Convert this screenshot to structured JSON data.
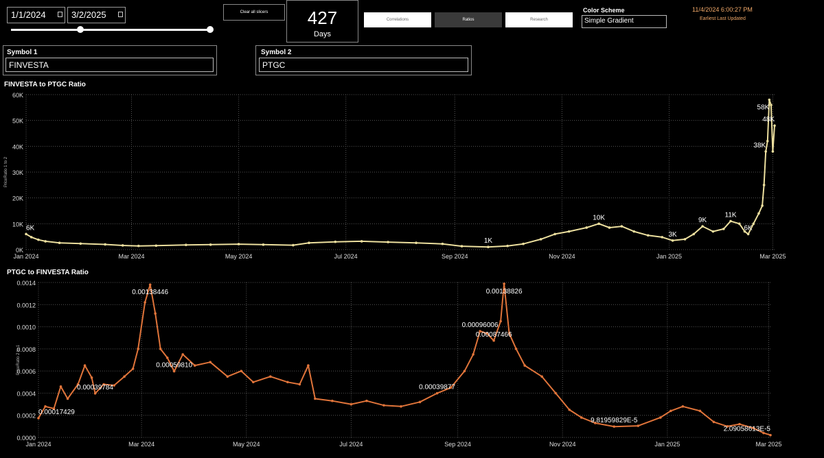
{
  "date_slicer": {
    "start": "1/1/2024",
    "end": "3/2/2025"
  },
  "clear_button": "Clear all slicers",
  "days_card": {
    "value": "427",
    "label": "Days"
  },
  "tabs": [
    {
      "label": "Correlations",
      "active": false
    },
    {
      "label": "Ratios",
      "active": true
    },
    {
      "label": "Research",
      "active": false
    }
  ],
  "color_scheme": {
    "label": "Color Scheme",
    "value": "Simple Gradient"
  },
  "last_updated": {
    "timestamp": "11/4/2024 6:00:27 PM",
    "label": "Earliest Last Updated"
  },
  "symbol1": {
    "label": "Symbol 1",
    "value": "FINVESTA"
  },
  "symbol2": {
    "label": "Symbol 2",
    "value": "PTGC"
  },
  "chart_data": [
    {
      "type": "line",
      "title": "FINVESTA to PTGC Ratio",
      "ylabel": "PriceRatio 1 to 2",
      "xlabel": "",
      "color": "#ecdf9e",
      "xlim": [
        "2024-01-01",
        "2025-03-02"
      ],
      "ylim": [
        0,
        60000
      ],
      "yticks": [
        0,
        10000,
        20000,
        30000,
        40000,
        50000,
        60000
      ],
      "ytick_labels": [
        "0K",
        "10K",
        "20K",
        "30K",
        "40K",
        "50K",
        "60K"
      ],
      "xticks": [
        "2024-01-01",
        "2024-03-01",
        "2024-05-01",
        "2024-07-01",
        "2024-09-01",
        "2024-11-01",
        "2025-01-01",
        "2025-03-01"
      ],
      "xtick_labels": [
        "Jan 2024",
        "Mar 2024",
        "May 2024",
        "Jul 2024",
        "Sep 2024",
        "Nov 2024",
        "Jan 2025",
        "Mar 2025"
      ],
      "grid": true,
      "points": [
        [
          "2024-01-01",
          6000
        ],
        [
          "2024-01-04",
          4800
        ],
        [
          "2024-01-08",
          3800
        ],
        [
          "2024-01-12",
          3200
        ],
        [
          "2024-01-20",
          2600
        ],
        [
          "2024-02-01",
          2300
        ],
        [
          "2024-02-15",
          2000
        ],
        [
          "2024-02-25",
          1600
        ],
        [
          "2024-03-05",
          1400
        ],
        [
          "2024-03-15",
          1500
        ],
        [
          "2024-04-01",
          1800
        ],
        [
          "2024-04-15",
          1900
        ],
        [
          "2024-05-01",
          2100
        ],
        [
          "2024-05-15",
          1900
        ],
        [
          "2024-06-01",
          1700
        ],
        [
          "2024-06-10",
          2600
        ],
        [
          "2024-06-25",
          3000
        ],
        [
          "2024-07-10",
          3200
        ],
        [
          "2024-07-25",
          2900
        ],
        [
          "2024-08-10",
          2600
        ],
        [
          "2024-08-25",
          2200
        ],
        [
          "2024-09-05",
          1300
        ],
        [
          "2024-09-20",
          1000
        ],
        [
          "2024-10-01",
          1400
        ],
        [
          "2024-10-10",
          2200
        ],
        [
          "2024-10-20",
          4000
        ],
        [
          "2024-10-28",
          6000
        ],
        [
          "2024-11-05",
          7000
        ],
        [
          "2024-11-15",
          8500
        ],
        [
          "2024-11-22",
          10000
        ],
        [
          "2024-11-28",
          8500
        ],
        [
          "2024-12-05",
          9000
        ],
        [
          "2024-12-12",
          7000
        ],
        [
          "2024-12-20",
          5500
        ],
        [
          "2024-12-28",
          4800
        ],
        [
          "2025-01-03",
          3500
        ],
        [
          "2025-01-10",
          4000
        ],
        [
          "2025-01-15",
          6000
        ],
        [
          "2025-01-20",
          9000
        ],
        [
          "2025-01-26",
          7000
        ],
        [
          "2025-02-01",
          8000
        ],
        [
          "2025-02-05",
          11000
        ],
        [
          "2025-02-10",
          10000
        ],
        [
          "2025-02-13",
          7000
        ],
        [
          "2025-02-15",
          6000
        ],
        [
          "2025-02-18",
          10000
        ],
        [
          "2025-02-21",
          14000
        ],
        [
          "2025-02-23",
          17000
        ],
        [
          "2025-02-24",
          25000
        ],
        [
          "2025-02-25",
          38000
        ],
        [
          "2025-02-26",
          42000
        ],
        [
          "2025-02-27",
          58000
        ],
        [
          "2025-02-28",
          56000
        ],
        [
          "2025-03-01",
          38000
        ],
        [
          "2025-03-02",
          48000
        ]
      ],
      "labels": [
        {
          "x": "2024-01-01",
          "y": 6000,
          "text": "6K"
        },
        {
          "x": "2024-09-20",
          "y": 1000,
          "text": "1K"
        },
        {
          "x": "2024-11-22",
          "y": 10000,
          "text": "10K"
        },
        {
          "x": "2025-01-03",
          "y": 3500,
          "text": "3K"
        },
        {
          "x": "2025-01-20",
          "y": 9000,
          "text": "9K"
        },
        {
          "x": "2025-02-05",
          "y": 11000,
          "text": "11K"
        },
        {
          "x": "2025-02-15",
          "y": 6000,
          "text": "6K"
        },
        {
          "x": "2025-02-25",
          "y": 38000,
          "text": "38K"
        },
        {
          "x": "2025-02-27",
          "y": 58000,
          "text": "58K"
        },
        {
          "x": "2025-03-02",
          "y": 48000,
          "text": "48K"
        }
      ]
    },
    {
      "type": "line",
      "title": "PTGC to FINVESTA Ratio",
      "ylabel": "PriceRatio 2 to 1",
      "xlabel": "",
      "color": "#e0743a",
      "xlim": [
        "2024-01-01",
        "2025-03-02"
      ],
      "ylim": [
        0,
        0.0014
      ],
      "yticks": [
        0,
        0.0002,
        0.0004,
        0.0006,
        0.0008,
        0.001,
        0.0012,
        0.0014
      ],
      "ytick_labels": [
        "0.0000",
        "0.0002",
        "0.0004",
        "0.0006",
        "0.0008",
        "0.0010",
        "0.0012",
        "0.0014"
      ],
      "xticks": [
        "2024-01-01",
        "2024-03-01",
        "2024-05-01",
        "2024-07-01",
        "2024-09-01",
        "2024-11-01",
        "2025-01-01",
        "2025-03-01"
      ],
      "xtick_labels": [
        "Jan 2024",
        "Mar 2024",
        "May 2024",
        "Jul 2024",
        "Sep 2024",
        "Nov 2024",
        "Jan 2025",
        "Mar 2025"
      ],
      "grid": true,
      "points": [
        [
          "2024-01-01",
          0.000174
        ],
        [
          "2024-01-05",
          0.00028
        ],
        [
          "2024-01-10",
          0.00026
        ],
        [
          "2024-01-14",
          0.00046
        ],
        [
          "2024-01-18",
          0.00035
        ],
        [
          "2024-01-24",
          0.00048
        ],
        [
          "2024-01-28",
          0.00065
        ],
        [
          "2024-02-01",
          0.00054
        ],
        [
          "2024-02-03",
          0.000398
        ],
        [
          "2024-02-08",
          0.00048
        ],
        [
          "2024-02-14",
          0.00047
        ],
        [
          "2024-02-20",
          0.00055
        ],
        [
          "2024-02-25",
          0.00062
        ],
        [
          "2024-02-28",
          0.0008
        ],
        [
          "2024-03-03",
          0.00122
        ],
        [
          "2024-03-06",
          0.00138
        ],
        [
          "2024-03-09",
          0.00112
        ],
        [
          "2024-03-12",
          0.0008
        ],
        [
          "2024-03-16",
          0.00072
        ],
        [
          "2024-03-20",
          0.000598
        ],
        [
          "2024-03-25",
          0.00075
        ],
        [
          "2024-04-01",
          0.00065
        ],
        [
          "2024-04-10",
          0.00068
        ],
        [
          "2024-04-20",
          0.00055
        ],
        [
          "2024-04-28",
          0.0006
        ],
        [
          "2024-05-05",
          0.0005
        ],
        [
          "2024-05-15",
          0.00055
        ],
        [
          "2024-05-25",
          0.0005
        ],
        [
          "2024-06-01",
          0.00048
        ],
        [
          "2024-06-06",
          0.00065
        ],
        [
          "2024-06-10",
          0.00035
        ],
        [
          "2024-06-20",
          0.00033
        ],
        [
          "2024-07-01",
          0.0003
        ],
        [
          "2024-07-10",
          0.00033
        ],
        [
          "2024-07-20",
          0.00029
        ],
        [
          "2024-07-30",
          0.00028
        ],
        [
          "2024-08-10",
          0.00032
        ],
        [
          "2024-08-20",
          0.000399
        ],
        [
          "2024-08-28",
          0.00045
        ],
        [
          "2024-09-05",
          0.0006
        ],
        [
          "2024-09-10",
          0.00075
        ],
        [
          "2024-09-14",
          0.00096
        ],
        [
          "2024-09-18",
          0.00094
        ],
        [
          "2024-09-22",
          0.00087466
        ],
        [
          "2024-09-26",
          0.00105
        ],
        [
          "2024-09-28",
          0.00138826
        ],
        [
          "2024-10-01",
          0.00094
        ],
        [
          "2024-10-05",
          0.0008
        ],
        [
          "2024-10-10",
          0.00065
        ],
        [
          "2024-10-20",
          0.00055
        ],
        [
          "2024-10-28",
          0.0004
        ],
        [
          "2024-11-05",
          0.00025
        ],
        [
          "2024-11-12",
          0.00018
        ],
        [
          "2024-11-20",
          0.00013
        ],
        [
          "2024-12-01",
          9.8e-05
        ],
        [
          "2024-12-15",
          0.000105
        ],
        [
          "2024-12-28",
          0.00018
        ],
        [
          "2025-01-03",
          0.00024
        ],
        [
          "2025-01-10",
          0.00028
        ],
        [
          "2025-01-20",
          0.00024
        ],
        [
          "2025-01-28",
          0.00014
        ],
        [
          "2025-02-05",
          0.0001
        ],
        [
          "2025-02-12",
          0.00012
        ],
        [
          "2025-02-20",
          8.5e-05
        ],
        [
          "2025-02-26",
          4e-05
        ],
        [
          "2025-03-02",
          2.09e-05
        ]
      ],
      "labels": [
        {
          "x": "2024-01-01",
          "y": 0.000174,
          "text": "0.00017429"
        },
        {
          "x": "2024-02-03",
          "y": 0.000398,
          "text": "0.00039784"
        },
        {
          "x": "2024-03-06",
          "y": 0.00138,
          "text": "0.00138446"
        },
        {
          "x": "2024-03-20",
          "y": 0.000598,
          "text": "0.00059810"
        },
        {
          "x": "2024-08-20",
          "y": 0.000399,
          "text": "0.00039877"
        },
        {
          "x": "2024-09-14",
          "y": 0.00096,
          "text": "0.00096006"
        },
        {
          "x": "2024-09-22",
          "y": 0.00087466,
          "text": "0.00087466"
        },
        {
          "x": "2024-09-28",
          "y": 0.00138826,
          "text": "0.00138826"
        },
        {
          "x": "2024-12-01",
          "y": 9.8e-05,
          "text": "9.81959829E-5"
        },
        {
          "x": "2025-03-02",
          "y": 2.09e-05,
          "text": "2.09058613E-5"
        }
      ]
    }
  ]
}
